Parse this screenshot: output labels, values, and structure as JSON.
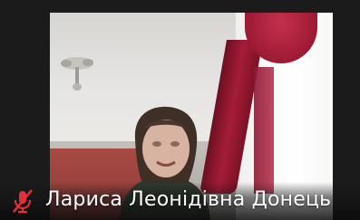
{
  "participant": {
    "name": "Лариса Леонідівна Донець",
    "mic_muted": true,
    "mute_icon": "microphone-muted-icon"
  },
  "colors": {
    "mute_icon": "#e0303a",
    "background": "#1b1b1b",
    "name_text": "#ffffff"
  }
}
